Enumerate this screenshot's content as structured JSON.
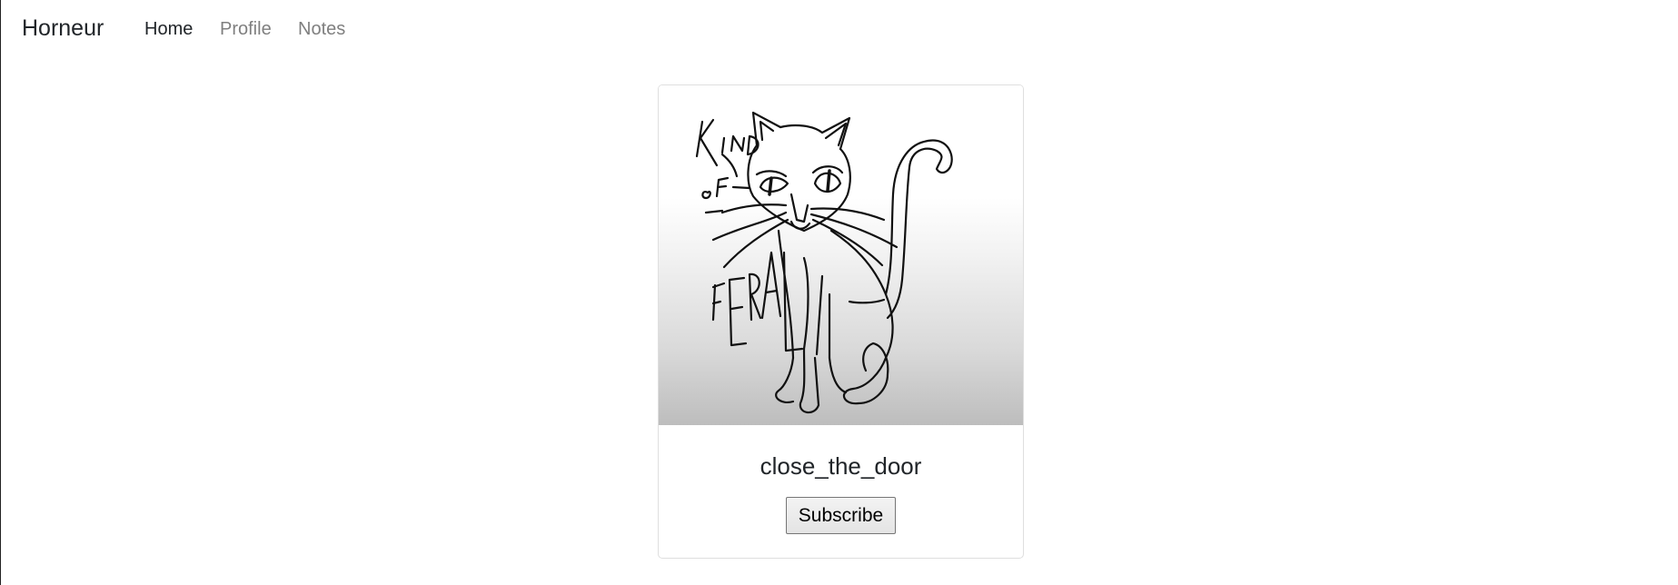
{
  "navbar": {
    "brand": "Horneur",
    "links": [
      {
        "label": "Home",
        "active": true
      },
      {
        "label": "Profile",
        "active": false
      },
      {
        "label": "Notes",
        "active": false
      }
    ]
  },
  "card": {
    "image_alt": "Kind of feral cat drawing",
    "image_icon": "cat-drawing",
    "title": "close_the_door",
    "button_label": "Subscribe"
  }
}
